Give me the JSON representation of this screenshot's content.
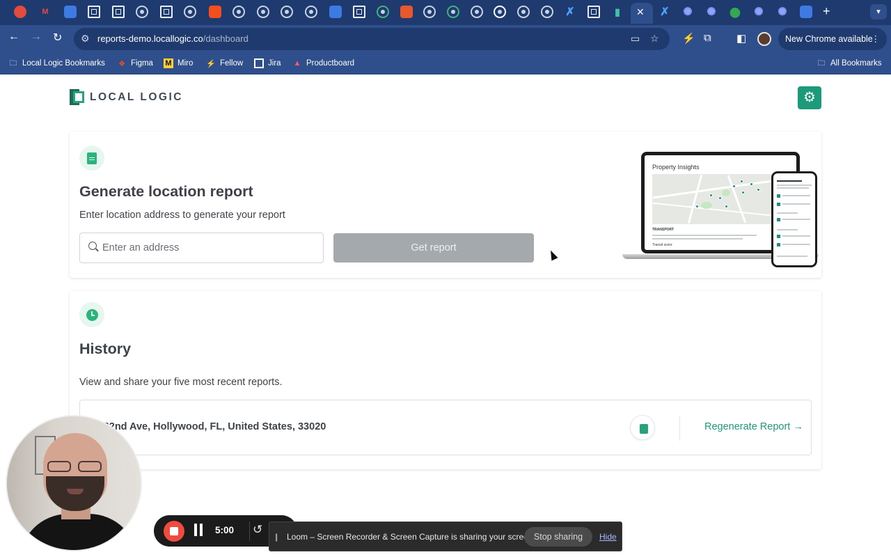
{
  "browser": {
    "url_host": "reports-demo.locallogic.co",
    "url_path": "/dashboard",
    "new_chrome_label": "New Chrome available",
    "bookmarks": [
      {
        "label": "Local Logic Bookmarks",
        "icon": "folder-icon"
      },
      {
        "label": "Figma",
        "icon": "figma-icon"
      },
      {
        "label": "Miro",
        "icon": "miro-icon"
      },
      {
        "label": "Fellow",
        "icon": "fellow-icon"
      },
      {
        "label": "Jira",
        "icon": "jira-icon"
      },
      {
        "label": "Productboard",
        "icon": "productboard-icon"
      }
    ],
    "all_bookmarks_label": "All Bookmarks"
  },
  "app": {
    "logo_text": "LOCAL LOGIC",
    "accent_color": "#1c9a7a"
  },
  "generate": {
    "title": "Generate location report",
    "subtitle": "Enter location address to generate your report",
    "input_placeholder": "Enter an address",
    "button_label": "Get report",
    "illustration": {
      "title": "Property Insights",
      "section": "TRANSPORT",
      "transit_label": "Transit score"
    }
  },
  "history": {
    "title": "History",
    "subtitle": "View and share your five most recent reports.",
    "items": [
      {
        "address": "S 22nd Ave, Hollywood, FL, United States, 33020",
        "action": "Regenerate Report →"
      }
    ]
  },
  "loom": {
    "timer": "5:00",
    "share_message": "Loom – Screen Recorder & Screen Capture is sharing your screen.",
    "stop_label": "Stop sharing",
    "hide_label": "Hide"
  }
}
